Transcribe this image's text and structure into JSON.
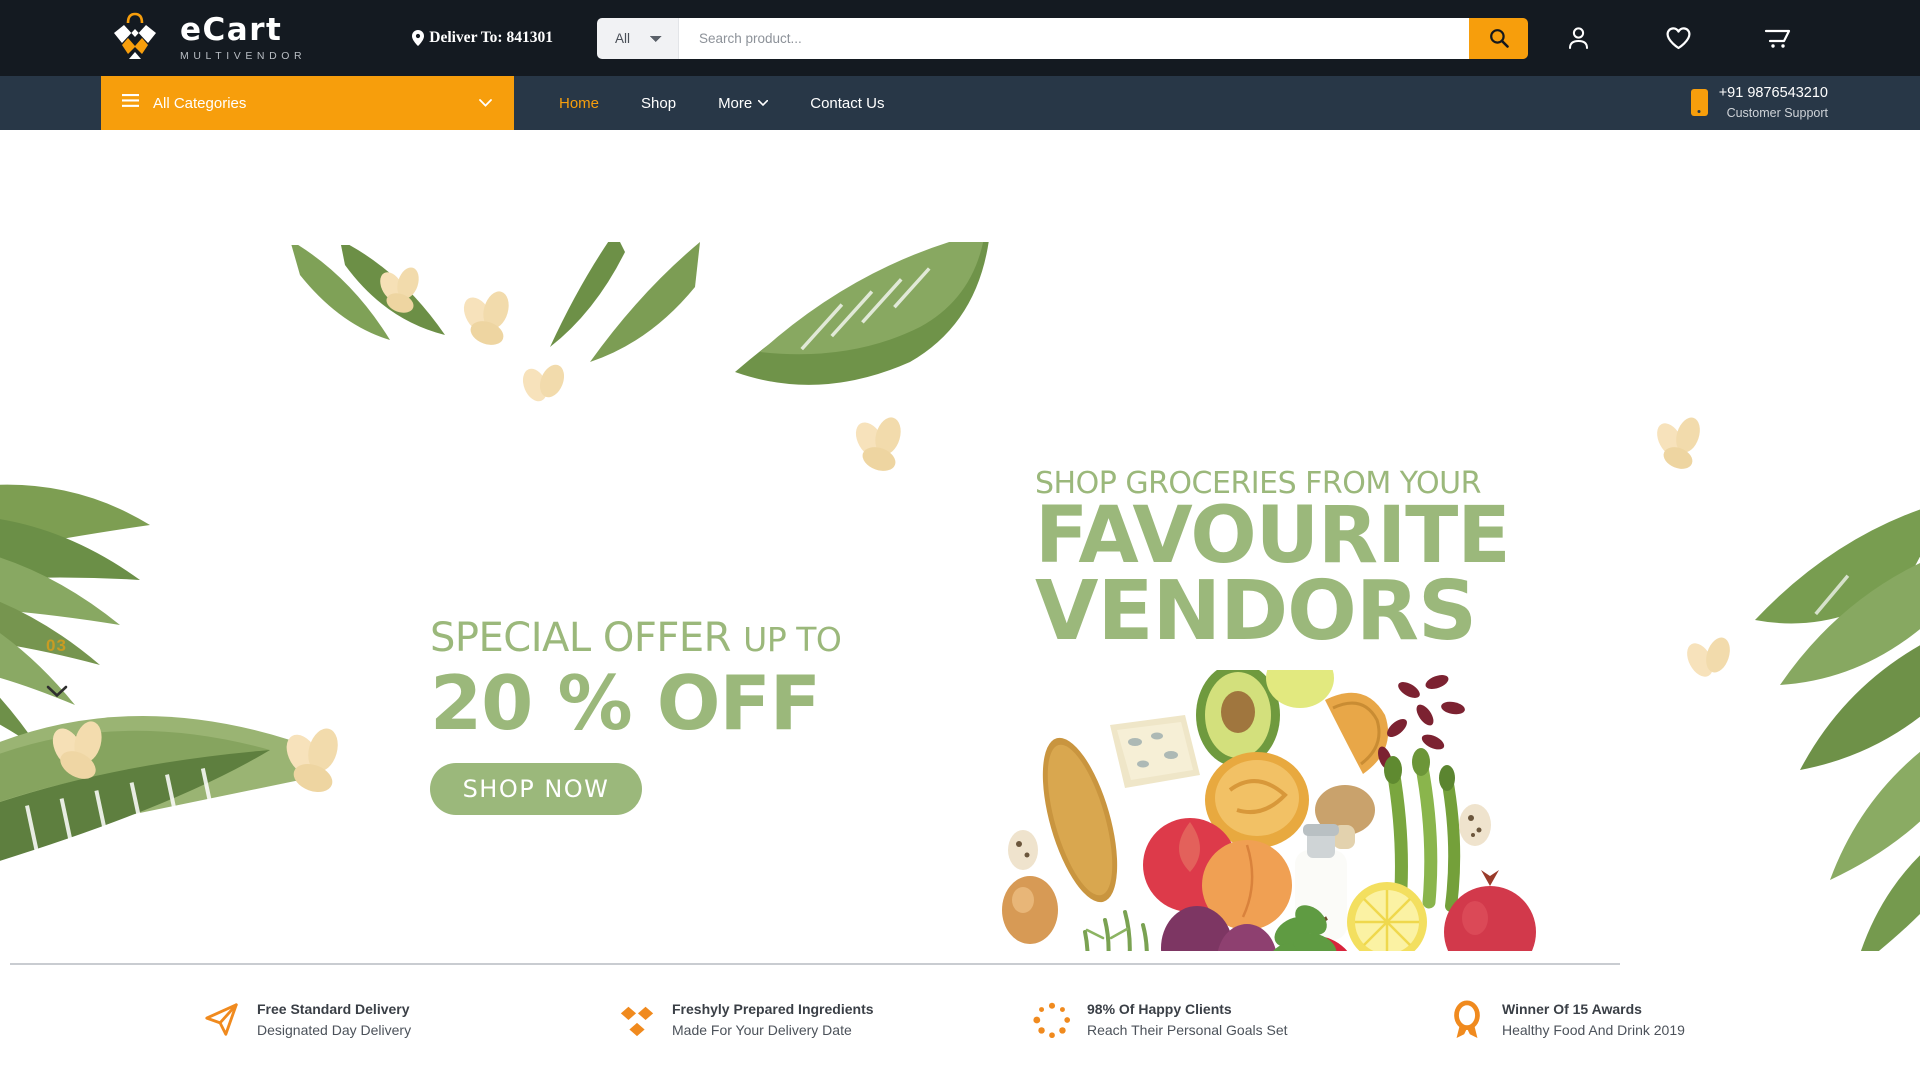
{
  "brand": {
    "name": "eCart",
    "tagline": "MULTIVENDOR",
    "logo_icon": "shopping-bag-logo",
    "accent_color": "#f79e0c",
    "header_bg": "#141a21",
    "nav_bg": "#283747"
  },
  "header": {
    "deliver_label": "Deliver To: 841301",
    "location_icon": "map-pin-icon",
    "search": {
      "category_selected": "All",
      "category_options": [
        "All"
      ],
      "placeholder": "Search product...",
      "value": "",
      "button_icon": "search-icon"
    },
    "icons": [
      {
        "name": "account-icon",
        "label": "Account"
      },
      {
        "name": "wishlist-heart-icon",
        "label": "Wishlist"
      },
      {
        "name": "shopping-cart-icon",
        "label": "Cart"
      }
    ]
  },
  "nav": {
    "all_categories": {
      "label": "All Categories",
      "menu_icon": "hamburger-icon",
      "chevron_icon": "chevron-down-icon"
    },
    "links": [
      {
        "label": "Home",
        "active": true,
        "has_caret": false
      },
      {
        "label": "Shop",
        "active": false,
        "has_caret": false
      },
      {
        "label": "More",
        "active": false,
        "has_caret": true
      },
      {
        "label": "Contact Us",
        "active": false,
        "has_caret": false
      }
    ],
    "support": {
      "icon": "mobile-phone-icon",
      "phone": "+91 9876543210",
      "caption": "Customer Support"
    }
  },
  "hero": {
    "slide_number": "03",
    "slide_next_icon": "chevron-down-icon",
    "offer": {
      "line1_main": "SPECIAL OFFER",
      "line1_small": "UP TO",
      "line2": "20 % OFF",
      "cta": "SHOP NOW"
    },
    "headline": {
      "line1": "SHOP GROCERIES FROM YOUR",
      "line2": "FAVOURITE",
      "line3": "VENDORS"
    },
    "image_alt": "grocery-bag-with-fresh-food",
    "green": "#9bb87b",
    "slide_number_color": "#c99b23"
  },
  "features": [
    {
      "icon": "paper-plane-icon",
      "title": "Free Standard Delivery",
      "subtitle": "Designated Day Delivery"
    },
    {
      "icon": "diamond-cluster-icon",
      "title": "Freshyly Prepared Ingredients",
      "subtitle": "Made For Your Delivery Date"
    },
    {
      "icon": "dotted-circle-icon",
      "title": "98% Of Happy Clients",
      "subtitle": "Reach Their Personal Goals Set"
    },
    {
      "icon": "award-ribbon-icon",
      "title": "Winner Of 15 Awards",
      "subtitle": "Healthy Food And Drink 2019"
    }
  ]
}
